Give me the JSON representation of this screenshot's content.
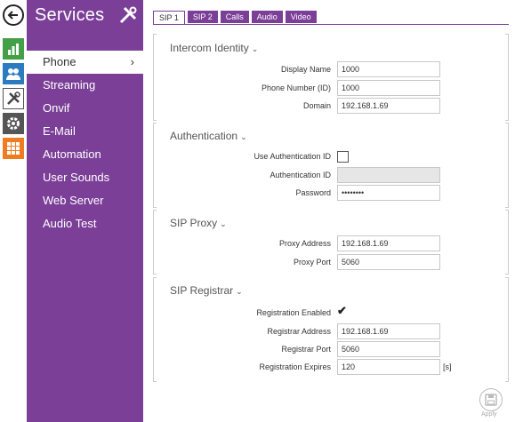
{
  "sidebar": {
    "title": "Services",
    "items": [
      {
        "label": "Phone",
        "active": true
      },
      {
        "label": "Streaming"
      },
      {
        "label": "Onvif"
      },
      {
        "label": "E-Mail"
      },
      {
        "label": "Automation"
      },
      {
        "label": "User Sounds"
      },
      {
        "label": "Web Server"
      },
      {
        "label": "Audio Test"
      }
    ],
    "active_chevron": "›"
  },
  "rail": {
    "icons": [
      "back-arrow-icon",
      "bar-chart-icon",
      "users-icon",
      "tools-icon",
      "gear-icon",
      "grid-icon"
    ],
    "colors": {
      "chart": "#43a047",
      "users": "#2b7bc0",
      "tools": "#555555",
      "gear": "#555555",
      "grid": "#f07c22"
    }
  },
  "tabs": [
    {
      "label": "SIP 1",
      "active": true
    },
    {
      "label": "SIP 2"
    },
    {
      "label": "Calls"
    },
    {
      "label": "Audio"
    },
    {
      "label": "Video"
    }
  ],
  "sections": {
    "identity": {
      "title": "Intercom Identity",
      "display_name_label": "Display Name",
      "display_name_value": "1000",
      "phone_number_label": "Phone Number (ID)",
      "phone_number_value": "1000",
      "domain_label": "Domain",
      "domain_value": "192.168.1.69"
    },
    "auth": {
      "title": "Authentication",
      "use_auth_id_label": "Use Authentication ID",
      "use_auth_id_checked": false,
      "auth_id_label": "Authentication ID",
      "auth_id_value": "",
      "password_label": "Password",
      "password_value": "••••••••"
    },
    "proxy": {
      "title": "SIP Proxy",
      "address_label": "Proxy Address",
      "address_value": "192.168.1.69",
      "port_label": "Proxy Port",
      "port_value": "5060"
    },
    "registrar": {
      "title": "SIP Registrar",
      "enabled_label": "Registration Enabled",
      "enabled_checked": true,
      "address_label": "Registrar Address",
      "address_value": "192.168.1.69",
      "port_label": "Registrar Port",
      "port_value": "5060",
      "expires_label": "Registration Expires",
      "expires_value": "120",
      "expires_unit": "[s]"
    }
  },
  "caret": "⌄",
  "checkmark": "✔",
  "apply_label": "Apply",
  "accent_color": "#7b3f98"
}
